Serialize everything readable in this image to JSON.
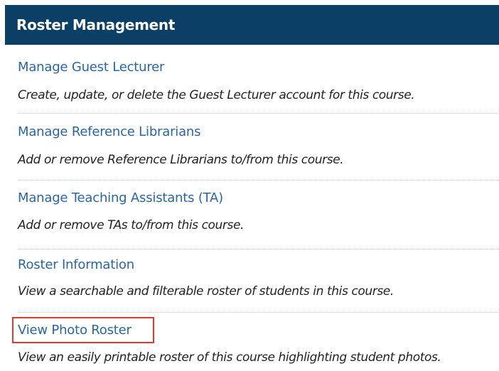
{
  "panel": {
    "title": "Roster Management"
  },
  "items": [
    {
      "link": "Manage Guest Lecturer",
      "description": "Create, update, or delete the Guest Lecturer account for this course."
    },
    {
      "link": "Manage Reference Librarians",
      "description": "Add or remove Reference Librarians to/from this course."
    },
    {
      "link": "Manage Teaching Assistants (TA)",
      "description": "Add or remove TAs to/from this course."
    },
    {
      "link": "Roster Information",
      "description": "View a searchable and filterable roster of students in this course."
    },
    {
      "link": "View Photo Roster",
      "description": "View an easily printable roster of this course highlighting student photos."
    }
  ],
  "colors": {
    "header_background": "#0b3f66",
    "link": "#2a66a3",
    "highlight_border": "#e03a2e"
  }
}
